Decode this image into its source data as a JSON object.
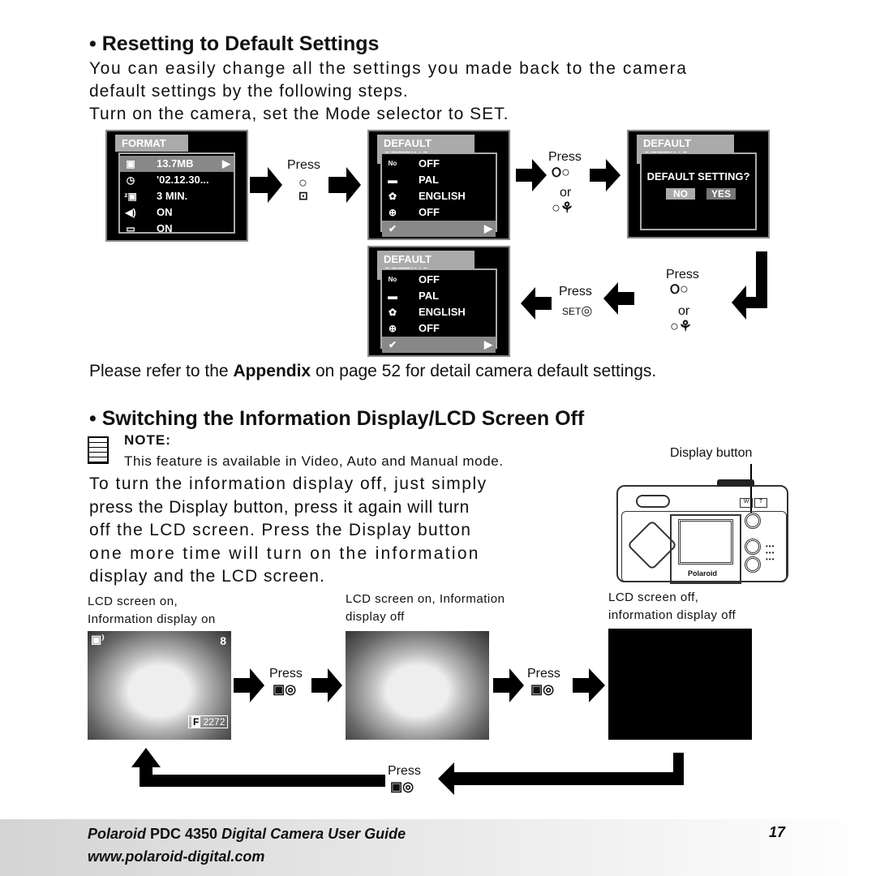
{
  "section1": {
    "heading": "• Resetting to Default Settings",
    "lines": [
      "You can easily change all the settings you made back to the camera",
      "default settings by the following steps.",
      "Turn on the camera, set the Mode selector to SET."
    ],
    "format_screen": {
      "tab": "FORMAT",
      "rows": [
        "13.7MB",
        "'02.12.30...",
        "3  MIN.",
        "ON",
        "ON"
      ]
    },
    "default_screen": {
      "tab": "DEFAULT  SETTING",
      "rows": [
        "OFF",
        "PAL",
        "ENGLISH",
        "OFF"
      ]
    },
    "confirm_screen": {
      "tab": "DEFAULT  SETTING",
      "question": "DEFAULT  SETTING?",
      "no": "NO",
      "yes": "YES"
    },
    "press": "Press",
    "or": "or",
    "set": "SET",
    "appendix_pre": "Please refer to the ",
    "appendix_bold": "Appendix",
    "appendix_post": " on page 52 for detail camera default settings."
  },
  "section2": {
    "heading": "• Switching the Information Display/LCD Screen Off",
    "note_label": "NOTE:",
    "note_text": "This feature is available in Video, Auto and Manual mode.",
    "display_button_label": "Display button",
    "camera_brand": "Polaroid",
    "body": [
      "To turn the information display off, just simply",
      "press the Display button, press it again will turn",
      "off the LCD screen. Press the Display button",
      "one more time will turn on the information",
      "display and the LCD screen."
    ],
    "captions": [
      [
        "LCD screen on,",
        "Information display on"
      ],
      [
        "LCD screen on, Information",
        "display off"
      ],
      [
        "LCD screen off,",
        "information display off"
      ]
    ],
    "osd_count": "8",
    "osd_size": "2272",
    "press": "Press"
  },
  "footer": {
    "brand": "Polaroid",
    "model": " PDC 4350 ",
    "title": "Digital Camera User Guide",
    "url": "www.polaroid-digital.com",
    "page": "17"
  }
}
